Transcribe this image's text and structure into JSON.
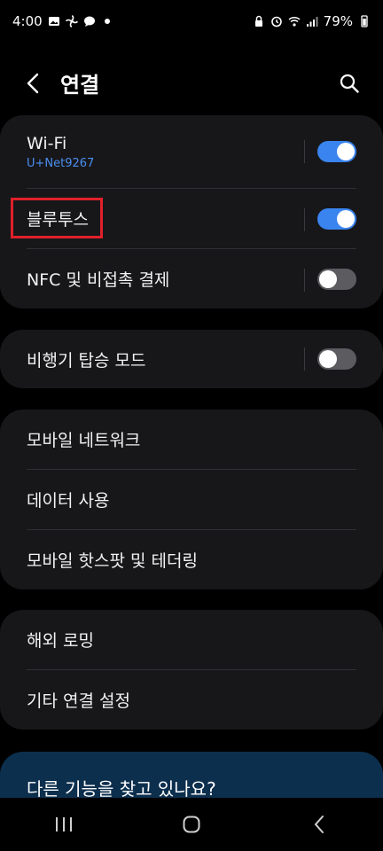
{
  "status_bar": {
    "time": "4:00",
    "battery": "79%"
  },
  "header": {
    "title": "연결"
  },
  "group1": {
    "wifi": {
      "label": "Wi-Fi",
      "network": "U+Net9267",
      "state": "on"
    },
    "bluetooth": {
      "label": "블루투스",
      "state": "on"
    },
    "nfc": {
      "label": "NFC 및 비접촉 결제",
      "state": "off"
    }
  },
  "group2": {
    "airplane": {
      "label": "비행기 탑승 모드",
      "state": "off"
    }
  },
  "group3": {
    "items": [
      {
        "label": "모바일 네트워크"
      },
      {
        "label": "데이터 사용"
      },
      {
        "label": "모바일 핫스팟 및 테더링"
      }
    ]
  },
  "group4": {
    "items": [
      {
        "label": "해외 로밍"
      },
      {
        "label": "기타 연결 설정"
      }
    ]
  },
  "promo": {
    "text": "다른 기능을 찾고 있나요?"
  },
  "colors": {
    "accent": "#3a84ef",
    "highlight": "#e0202a",
    "card": "#17171a"
  }
}
